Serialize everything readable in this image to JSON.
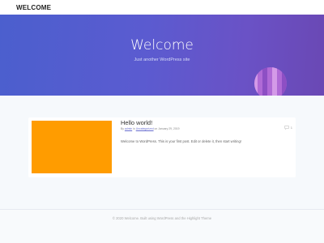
{
  "header": {
    "site_title": "WELCOME"
  },
  "hero": {
    "title": "Welcome",
    "tagline": "Just another WordPress site",
    "gradient_colors": [
      "#4b5fce",
      "#6a48b4"
    ]
  },
  "post": {
    "title": "Hello world!",
    "meta_by": "By",
    "author": "admin",
    "meta_in": "in",
    "category": "Uncategorized",
    "meta_on": "on",
    "date": "January 29, 2019",
    "excerpt": "Welcome to WordPress. This is your first post. Edit or delete it, then start writing!",
    "comment_count": "1",
    "comment_icon": "comment-bubble-icon",
    "thumbnail_color": "#ff9c00"
  },
  "footer": {
    "text": "© 2020 Welcome. Built using WordPress and the Highlight Theme"
  }
}
